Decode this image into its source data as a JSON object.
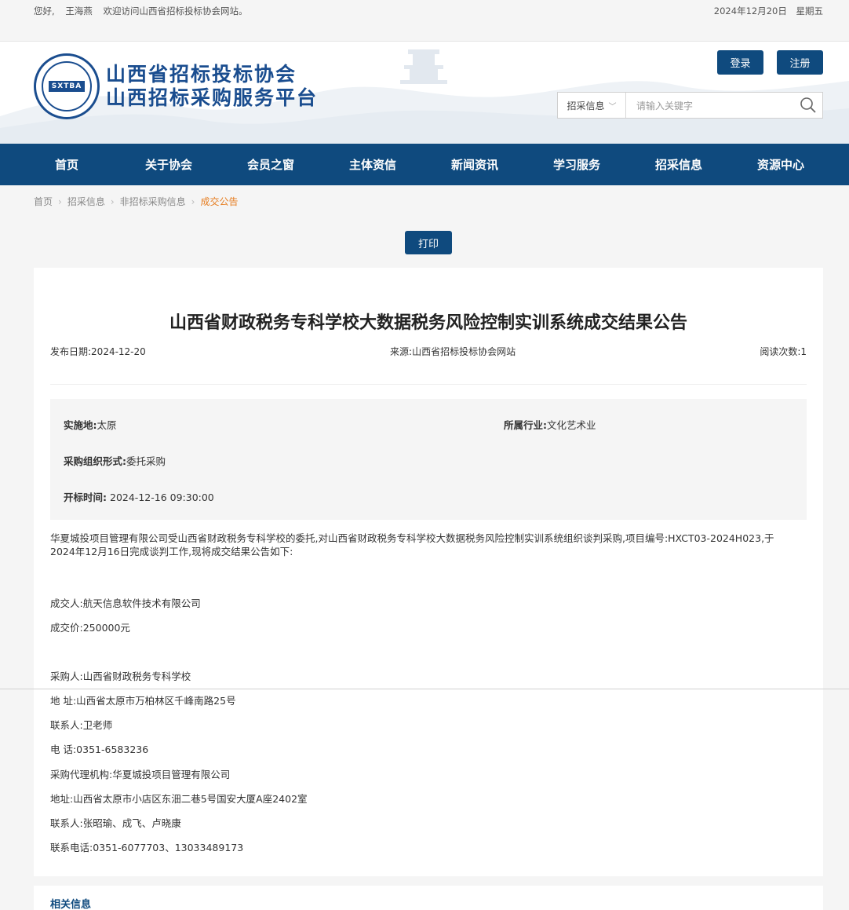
{
  "topbar": {
    "greeting": "您好,",
    "username": "王海燕",
    "welcome": "欢迎访问山西省招标投标协会网站。",
    "date": "2024年12月20日",
    "weekday": "星期五"
  },
  "header": {
    "logo_line1": "山西省招标投标协会",
    "logo_line2": "山西招标采购服务平台",
    "seal_text": "SXTBA",
    "login_label": "登录",
    "register_label": "注册",
    "search_category": "招采信息",
    "search_placeholder": "请输入关键字"
  },
  "nav": {
    "items": [
      "首页",
      "关于协会",
      "会员之窗",
      "主体资信",
      "新闻资讯",
      "学习服务",
      "招采信息",
      "资源中心"
    ]
  },
  "breadcrumb": {
    "items": [
      "首页",
      "招采信息",
      "非招标采购信息"
    ],
    "current": "成交公告"
  },
  "print_label": "打印",
  "article": {
    "title": "山西省财政税务专科学校大数据税务风险控制实训系统成交结果公告",
    "publish_date": "发布日期:2024-12-20",
    "source": "来源:山西省招标投标协会网站",
    "read_count": "阅读次数:1",
    "info": {
      "location_label": "实施地:",
      "location": "太原",
      "industry_label": "所属行业:",
      "industry": "文化艺术业",
      "form_label": "采购组织形式:",
      "form": "委托采购",
      "open_label": "开标时间:",
      "open_time": "2024-12-16 09:30:00"
    },
    "intro": "华夏城投项目管理有限公司受山西省财政税务专科学校的委托,对山西省财政税务专科学校大数据税务风险控制实训系统组织谈判采购,项目编号:HXCT03-2024H023,于2024年12月16日完成谈判工作,现将成交结果公告如下:",
    "winner": "成交人:航天信息软件技术有限公司",
    "price": "成交价:250000元",
    "purchaser": "采购人:山西省财政税务专科学校",
    "purchaser_address": "地 址:山西省太原市万柏林区千峰南路25号",
    "purchaser_contact": "联系人:卫老师",
    "purchaser_phone": "电 话:0351-6583236",
    "agent": "采购代理机构:华夏城投项目管理有限公司",
    "agent_address": "地址:山西省太原市小店区东沺二巷5号国安大厦A座2402室",
    "agent_contact": "联系人:张昭瑜、成飞、卢晓康",
    "agent_phone": "联系电话:0351-6077703、13033489173"
  },
  "related": {
    "title": "相关信息"
  }
}
